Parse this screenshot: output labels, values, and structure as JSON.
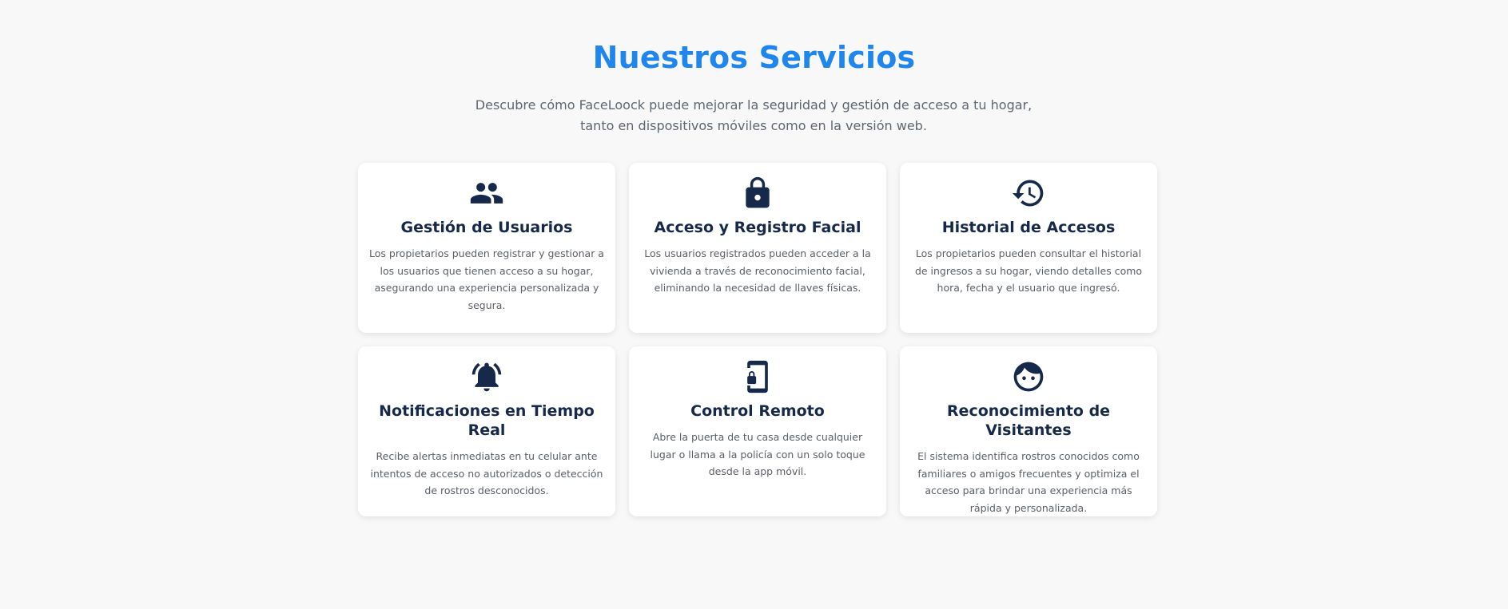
{
  "section": {
    "title": "Nuestros Servicios",
    "subtitle_line1": "Descubre cómo FaceLoock puede mejorar la seguridad y gestión de acceso a tu hogar,",
    "subtitle_line2": "tanto en dispositivos móviles como en la versión web."
  },
  "colors": {
    "accent": "#1f86ee",
    "icon": "#17294a",
    "card_bg": "#ffffff",
    "page_bg": "#f8f8f8"
  },
  "services": [
    {
      "icon": "users-icon",
      "title": "Gestión de Usuarios",
      "description": "Los propietarios pueden registrar y gestionar a los usuarios que tienen acceso a su hogar, asegurando una experiencia personalizada y segura."
    },
    {
      "icon": "lock-icon",
      "title": "Acceso y Registro Facial",
      "description": "Los usuarios registrados pueden acceder a la vivienda a través de reconocimiento facial, eliminando la necesidad de llaves físicas."
    },
    {
      "icon": "history-icon",
      "title": "Historial de Accesos",
      "description": "Los propietarios pueden consultar el historial de ingresos a su hogar, viendo detalles como hora, fecha y el usuario que ingresó."
    },
    {
      "icon": "bell-ringing-icon",
      "title": "Notificaciones en Tiempo Real",
      "description": "Recibe alertas inmediatas en tu celular ante intentos de acceso no autorizados o detección de rostros desconocidos."
    },
    {
      "icon": "phone-lock-icon",
      "title": "Control Remoto",
      "description": "Abre la puerta de tu casa desde cualquier lugar o llama a la policía con un solo toque desde la app móvil."
    },
    {
      "icon": "face-icon",
      "title": "Reconocimiento de Visitantes",
      "description": "El sistema identifica rostros conocidos como familiares o amigos frecuentes y optimiza el acceso para brindar una experiencia más rápida y personalizada."
    }
  ]
}
